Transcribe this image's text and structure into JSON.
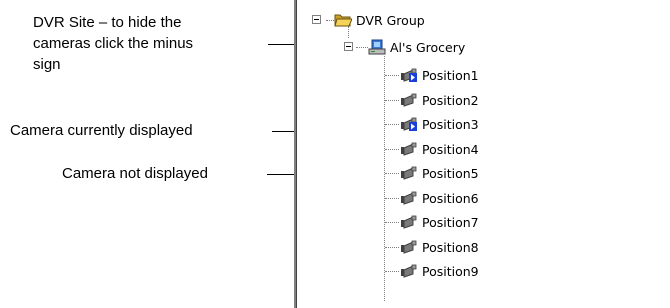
{
  "callouts": {
    "dvr_site_line1": "DVR Site – to hide the",
    "dvr_site_line2": "cameras click the minus",
    "dvr_site_line3": "sign",
    "camera_displayed": "Camera currently displayed",
    "camera_not_displayed": "Camera not displayed"
  },
  "tree": {
    "root": {
      "label": "DVR Group",
      "icon": "folder-open-icon",
      "expanded": true
    },
    "site": {
      "label": "Al's Grocery",
      "icon": "dvr-site-icon",
      "expanded": true
    },
    "cameras": [
      {
        "label": "Position1",
        "displayed": true
      },
      {
        "label": "Position2",
        "displayed": false
      },
      {
        "label": "Position3",
        "displayed": true
      },
      {
        "label": "Position4",
        "displayed": false
      },
      {
        "label": "Position5",
        "displayed": false
      },
      {
        "label": "Position6",
        "displayed": false
      },
      {
        "label": "Position7",
        "displayed": false
      },
      {
        "label": "Position8",
        "displayed": false
      },
      {
        "label": "Position9",
        "displayed": false
      }
    ]
  },
  "colors": {
    "camera_body": "#404040",
    "displayed_indicator": "#1a3fd8",
    "folder": "#e8c24a",
    "tree_lines": "#808080"
  }
}
